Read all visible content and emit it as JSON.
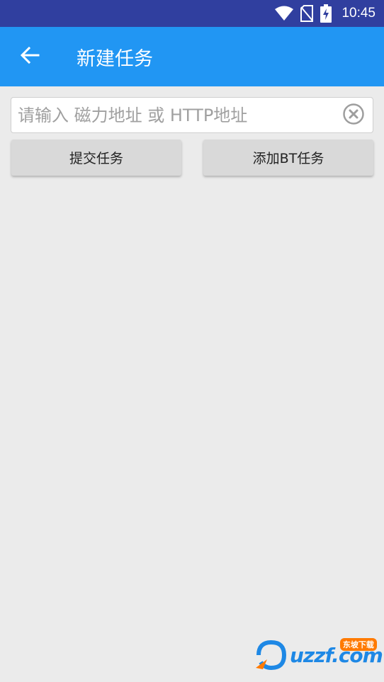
{
  "status_bar": {
    "time": "10:45",
    "icons": [
      "wifi-icon",
      "no-sim-icon",
      "battery-charging-icon"
    ]
  },
  "app_bar": {
    "title": "新建任务",
    "back_icon": "arrow-back-icon",
    "color": "#2196f3"
  },
  "form": {
    "url_placeholder": "请输入 磁力地址 或 HTTP地址",
    "url_value": "",
    "clear_icon": "clear-circle-icon",
    "submit_label": "提交任务",
    "add_bt_label": "添加BT任务"
  },
  "watermark": {
    "text": "uzzf.com",
    "badge": "东坡下载"
  },
  "colors": {
    "status_bar": "#303f9f",
    "background": "#ebebeb",
    "button": "#d9d9d9"
  }
}
